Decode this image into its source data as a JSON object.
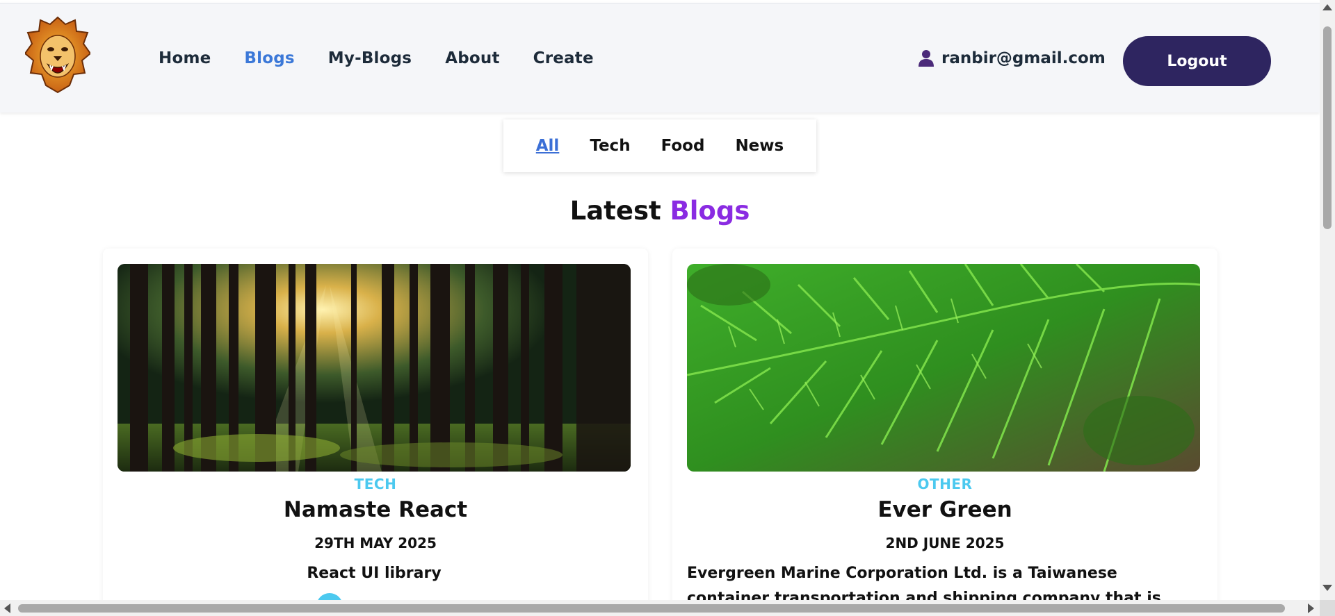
{
  "header": {
    "nav": [
      {
        "label": "Home",
        "active": false
      },
      {
        "label": "Blogs",
        "active": true
      },
      {
        "label": "My-Blogs",
        "active": false
      },
      {
        "label": "About",
        "active": false
      },
      {
        "label": "Create",
        "active": false
      }
    ],
    "user_email": "ranbir@gmail.com",
    "logout_label": "Logout",
    "logo_icon": "lion-logo-icon",
    "user_icon": "user-icon"
  },
  "filter": {
    "items": [
      {
        "label": "All",
        "active": true
      },
      {
        "label": "Tech",
        "active": false
      },
      {
        "label": "Food",
        "active": false
      },
      {
        "label": "News",
        "active": false
      }
    ]
  },
  "section": {
    "title_main": "Latest ",
    "title_accent": "Blogs"
  },
  "cards": [
    {
      "category": "TECH",
      "title": "Namaste React",
      "date": "29TH MAY 2025",
      "description": "React UI library",
      "image": "forest-sunlight-image"
    },
    {
      "category": "OTHER",
      "title": "Ever Green",
      "date": "2ND JUNE 2025",
      "description": "Evergreen Marine Corporation Ltd. is a Taiwanese container transportation and shipping company that is headquartered in",
      "image": "evergreen-branch-image"
    }
  ],
  "colors": {
    "brand_dark": "#2e2560",
    "link_active": "#3b78d8",
    "accent_purple": "#8a2be2",
    "category_cyan": "#4cc9ef"
  }
}
